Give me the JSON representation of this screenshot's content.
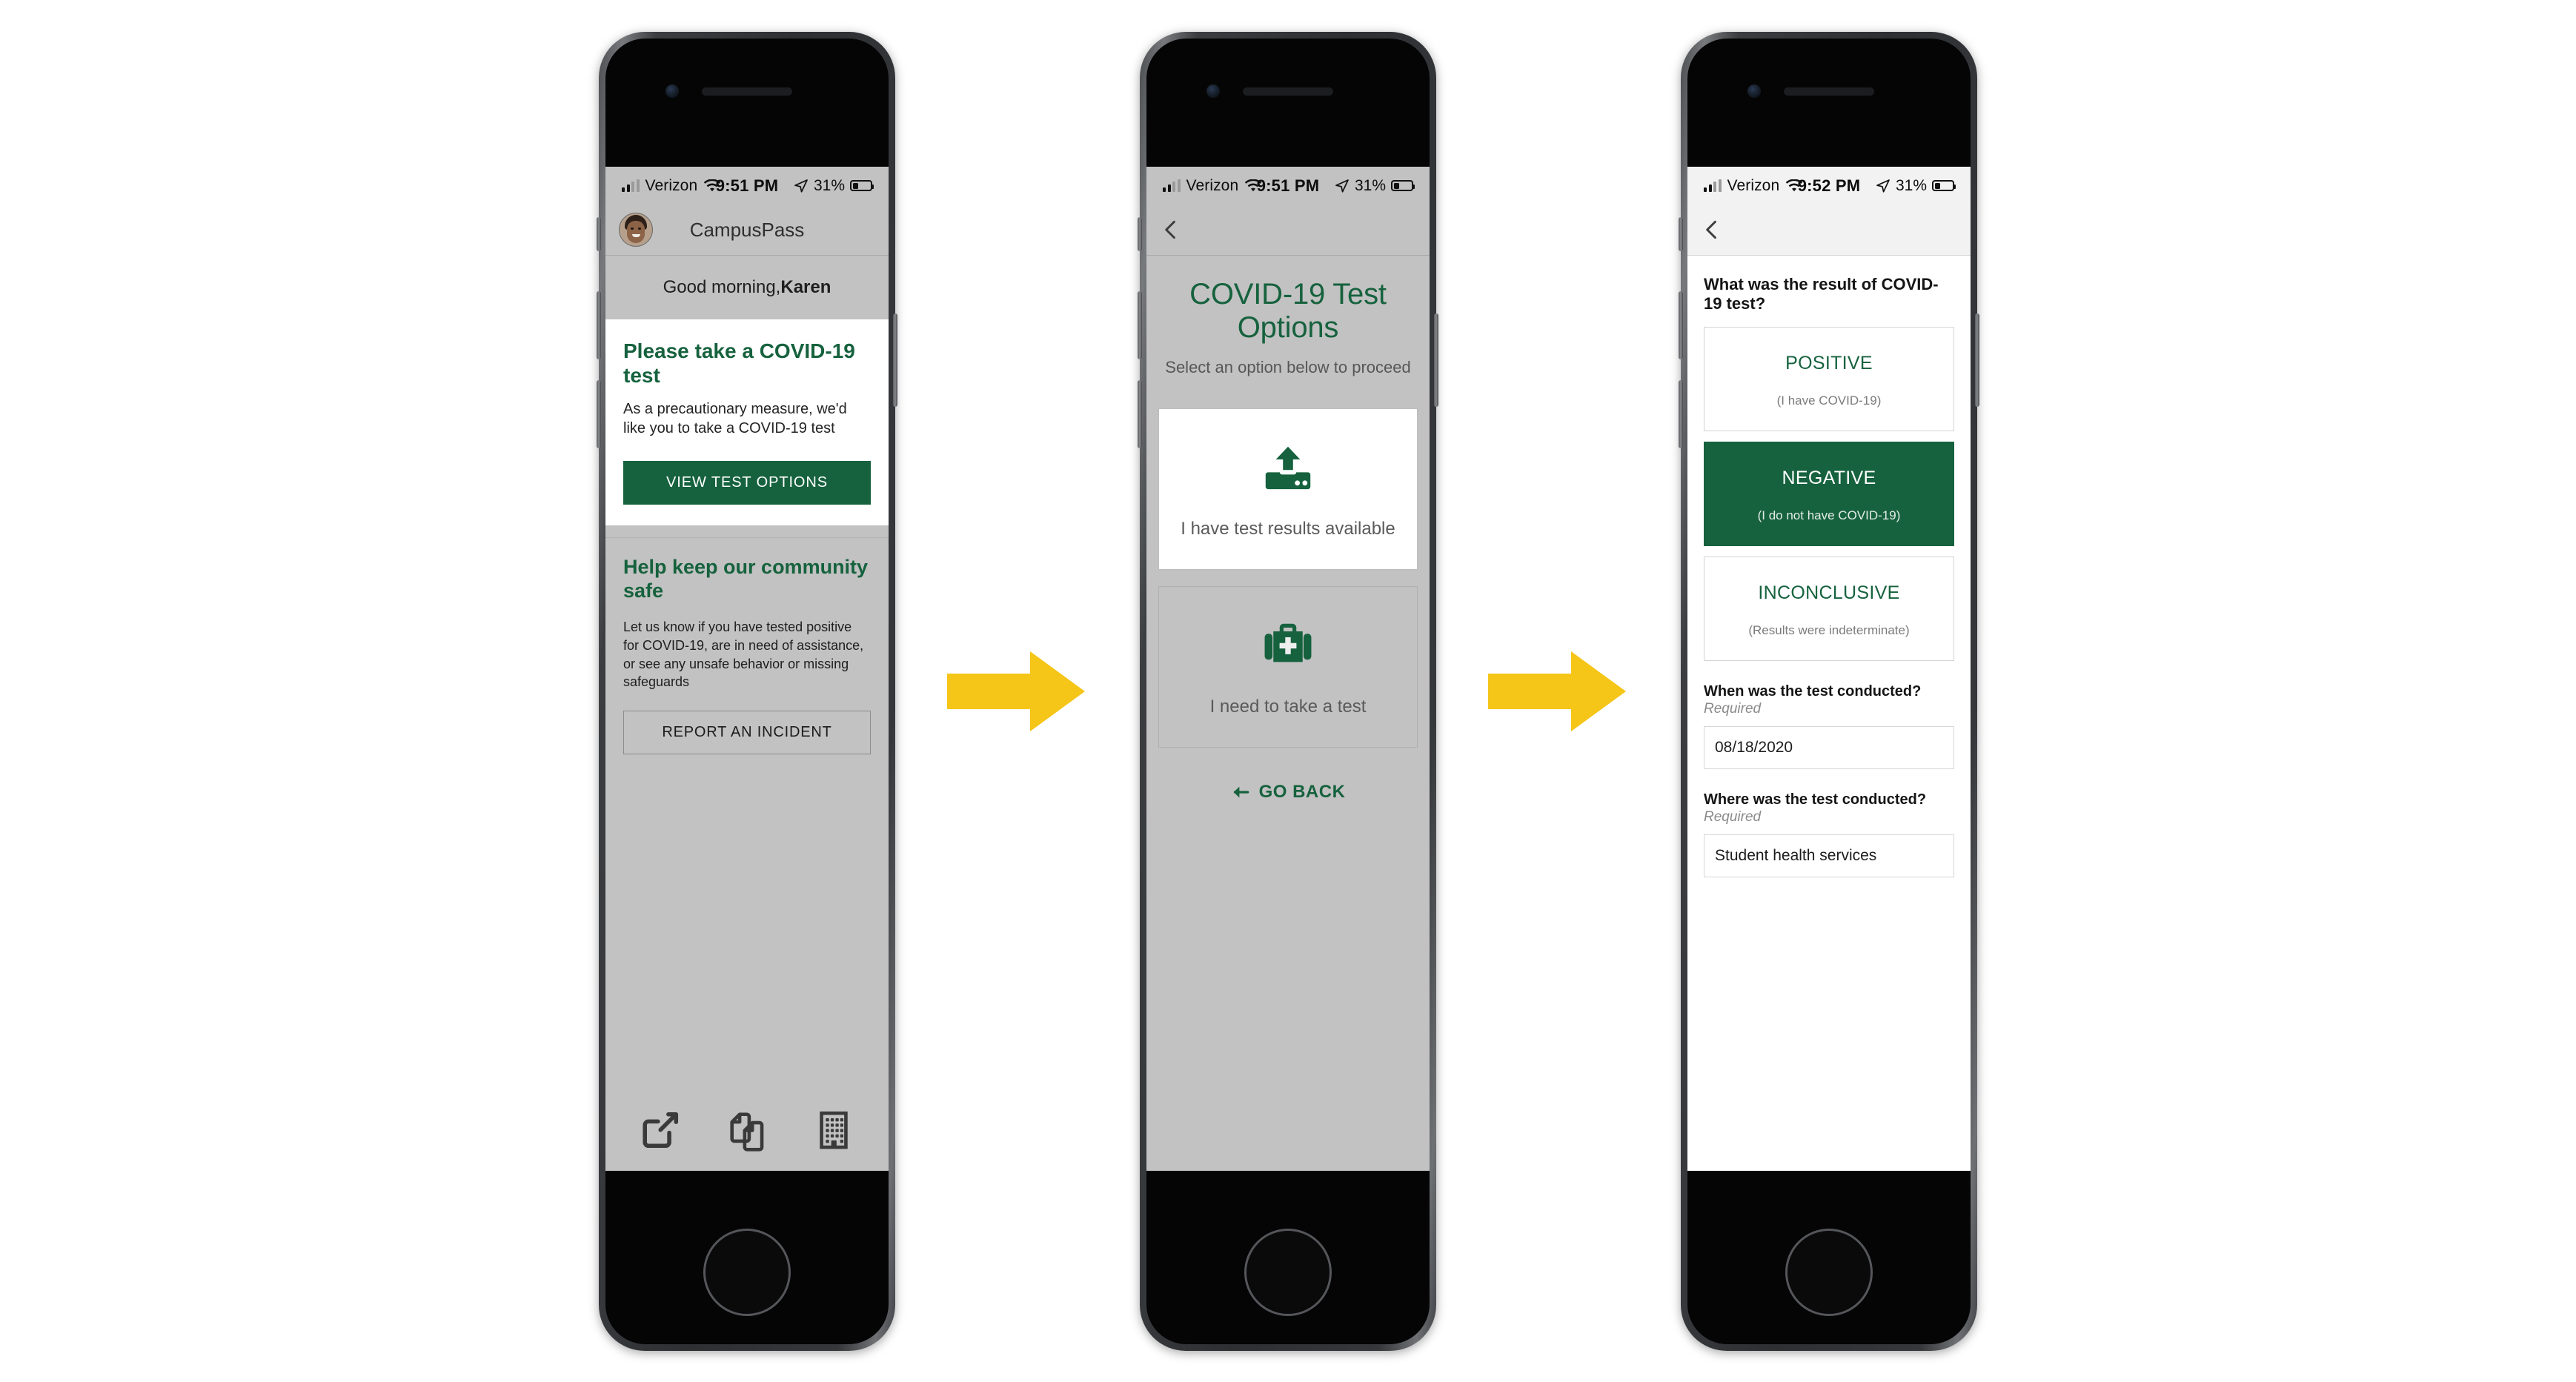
{
  "colors": {
    "brand_green": "#16623e",
    "arrow_yellow": "#f5c518",
    "screen_grey": "#c2c2c2",
    "card_white": "#ffffff"
  },
  "phone1": {
    "status_bar": {
      "carrier": "Verizon",
      "time": "9:51 PM",
      "battery_pct": "31%",
      "signal_icon": "cellular-bars-icon",
      "wifi_icon": "wifi-icon",
      "location_icon": "location-arrow-icon",
      "battery_icon": "battery-icon"
    },
    "nav": {
      "avatar_icon": "avatar",
      "title": "CampusPass"
    },
    "greeting": {
      "prefix": "Good morning, ",
      "name": "Karen"
    },
    "alert_card": {
      "title": "Please take a COVID-19 test",
      "body": "As a precautionary measure, we'd like you to take a COVID-19 test",
      "button": "VIEW TEST OPTIONS"
    },
    "community_card": {
      "title": "Help keep our community safe",
      "body": "Let us know if you have tested positive for COVID-19, are in need of assistance, or see any unsafe behavior or missing safeguards",
      "button": "REPORT AN INCIDENT"
    },
    "tabbar": [
      {
        "icon": "external-link-icon"
      },
      {
        "icon": "documents-copy-icon"
      },
      {
        "icon": "building-icon"
      }
    ]
  },
  "phone2": {
    "status_bar": {
      "carrier": "Verizon",
      "time": "9:51 PM",
      "battery_pct": "31%"
    },
    "nav": {
      "back_icon": "back-chevron-icon"
    },
    "title": "COVID-19 Test Options",
    "subtitle": "Select an option below to proceed",
    "options": [
      {
        "icon": "upload-icon",
        "label": "I have test results available"
      },
      {
        "icon": "first-aid-kit-icon",
        "label": "I need to take a test"
      }
    ],
    "go_back": {
      "icon": "arrow-left-icon",
      "label": "GO BACK"
    }
  },
  "phone3": {
    "status_bar": {
      "carrier": "Verizon",
      "time": "9:52 PM",
      "battery_pct": "31%"
    },
    "nav": {
      "back_icon": "back-chevron-icon"
    },
    "question": "What was the result of COVID-19 test?",
    "results": [
      {
        "label": "POSITIVE",
        "sub": "(I have COVID-19)",
        "selected": false
      },
      {
        "label": "NEGATIVE",
        "sub": "(I do not have COVID-19)",
        "selected": true
      },
      {
        "label": "INCONCLUSIVE",
        "sub": "(Results were indeterminate)",
        "selected": false
      }
    ],
    "fields": [
      {
        "label": "When was the test conducted?",
        "required": "Required",
        "value": "08/18/2020"
      },
      {
        "label": "Where was the test conducted?",
        "required": "Required",
        "value": "Student health services"
      }
    ]
  },
  "flow": {
    "arrow1_icon": "right-arrow-icon",
    "arrow2_icon": "right-arrow-icon"
  }
}
